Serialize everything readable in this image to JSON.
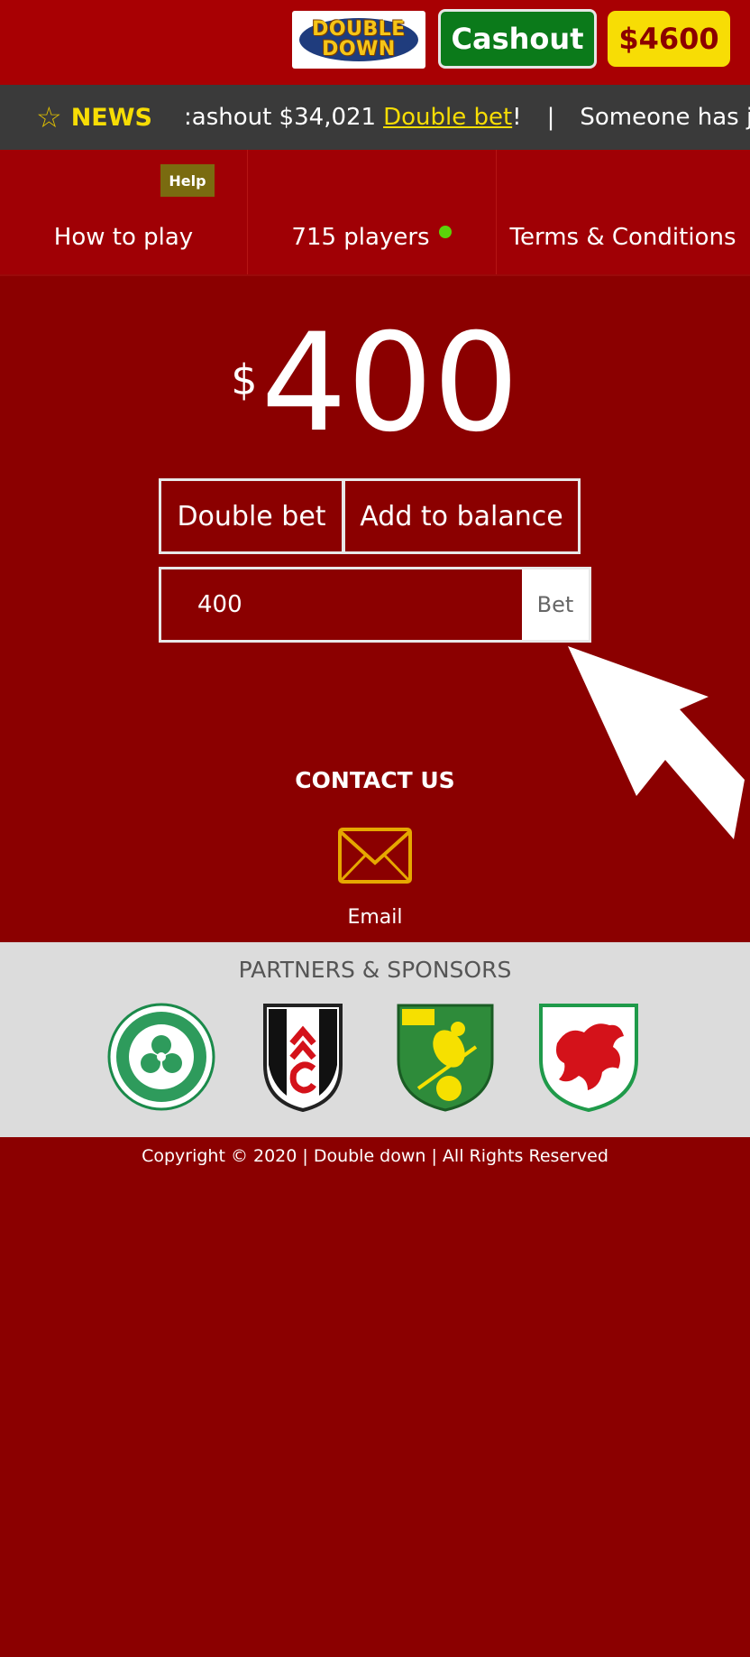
{
  "header": {
    "logo_line1": "DOUBLE",
    "logo_line2": "DOWN",
    "cashout_label": "Cashout",
    "balance": "$4600"
  },
  "news": {
    "label": "NEWS",
    "ticker_text": ":ashout $34,021",
    "ticker_highlight": "Double bet",
    "ticker_after": "!",
    "separator": "|",
    "ticker_next": "Someone has jus"
  },
  "nav": {
    "help_badge": "Help",
    "how_to_play": "How to play",
    "players": "715 players",
    "terms": "Terms & Conditions"
  },
  "bet": {
    "currency": "$",
    "amount": "400",
    "double_bet_label": "Double bet",
    "add_to_balance_label": "Add to balance",
    "input_value": "400",
    "bet_label": "Bet"
  },
  "contact": {
    "title": "CONTACT US",
    "email_label": "Email"
  },
  "partners": {
    "title": "PARTNERS & SPONSORS",
    "logos": [
      "celtic-crest",
      "fulham-crest",
      "norwich-crest",
      "wales-crest"
    ]
  },
  "footer": {
    "copyright": "Copyright © 2020 | Double down | All Rights Reserved"
  },
  "colors": {
    "background": "#8b0000",
    "header": "#a80003",
    "cashout_green": "#0b7a1a",
    "balance_yellow": "#f7dd05",
    "news_bar": "#3a3a3a",
    "partners_bg": "#dcdcdc"
  }
}
